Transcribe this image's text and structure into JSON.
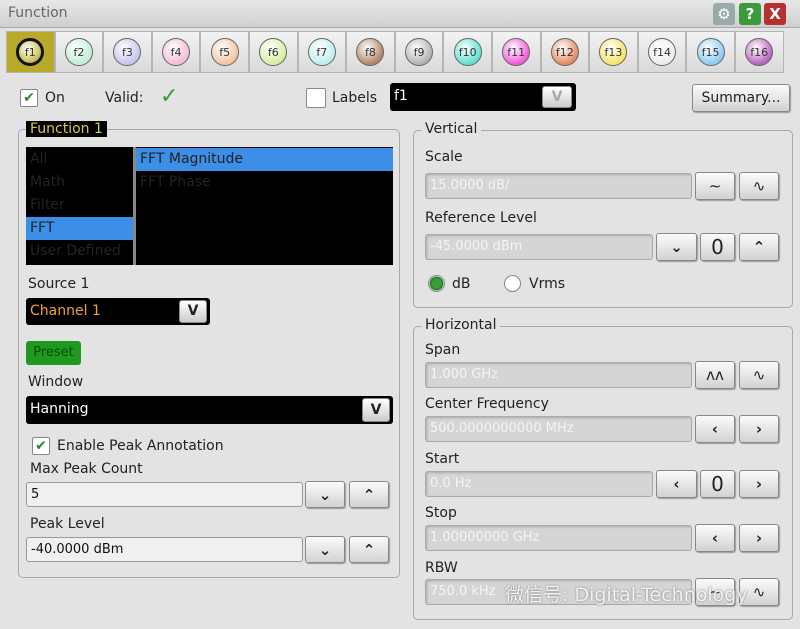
{
  "window": {
    "title": "Function",
    "buttons": [
      "settings",
      "help",
      "close"
    ],
    "help_label": "?",
    "close_label": "X"
  },
  "tabs": [
    {
      "label": "f1",
      "color": "#c8bc4a"
    },
    {
      "label": "f2",
      "color": "#bfeed6"
    },
    {
      "label": "f3",
      "color": "#c5c3ec"
    },
    {
      "label": "f4",
      "color": "#f2bcd4"
    },
    {
      "label": "f5",
      "color": "#f2c4a2"
    },
    {
      "label": "f6",
      "color": "#d6ef9f"
    },
    {
      "label": "f7",
      "color": "#bfeeea"
    },
    {
      "label": "f8",
      "color": "#b08466"
    },
    {
      "label": "f9",
      "color": "#b2b2b2"
    },
    {
      "label": "f10",
      "color": "#5fe0d0"
    },
    {
      "label": "f11",
      "color": "#f05ad8"
    },
    {
      "label": "f12",
      "color": "#e38a5e"
    },
    {
      "label": "f13",
      "color": "#f3e468"
    },
    {
      "label": "f14",
      "color": "#ececec"
    },
    {
      "label": "f15",
      "color": "#8dc9f2"
    },
    {
      "label": "f16",
      "color": "#b565bd"
    }
  ],
  "top": {
    "on_label": "On",
    "on_checked": true,
    "valid_label": "Valid:",
    "valid_icon": "checkmark",
    "labels_label": "Labels",
    "labels_checked": false,
    "label_value": "f1",
    "summary_label": "Summary..."
  },
  "function": {
    "legend": "Function 1",
    "categories": [
      "All",
      "Math",
      "Filter",
      "FFT",
      "User Defined"
    ],
    "selected_category": "FFT",
    "operators": [
      "FFT Magnitude",
      "FFT Phase"
    ],
    "selected_operator": "FFT Magnitude",
    "source_label": "Source 1",
    "source_value": "Channel 1",
    "preset_label": "Preset",
    "window_label": "Window",
    "window_value": "Hanning",
    "peak_annotation_label": "Enable Peak Annotation",
    "peak_annotation_checked": true,
    "max_peak_label": "Max Peak Count",
    "max_peak_value": "5",
    "peak_level_label": "Peak Level",
    "peak_level_value": "-40.0000 dBm"
  },
  "vertical": {
    "legend": "Vertical",
    "scale_label": "Scale",
    "scale_value": "15.0000 dB/",
    "ref_label": "Reference Level",
    "ref_value": "-45.0000 dBm",
    "zero_label": "0",
    "unit_db": "dB",
    "unit_vrms": "Vrms",
    "selected_unit": "dB"
  },
  "horizontal": {
    "legend": "Horizontal",
    "span_label": "Span",
    "span_value": "1.000 GHz",
    "center_label": "Center Frequency",
    "center_value": "500.0000000000 MHz",
    "start_label": "Start",
    "start_value": "0.0 Hz",
    "zero_label": "0",
    "stop_label": "Stop",
    "stop_value": "1.00000000 GHz",
    "rbw_label": "RBW",
    "rbw_value": "750.0 kHz"
  },
  "watermark": "微信号: Digital-Technology"
}
